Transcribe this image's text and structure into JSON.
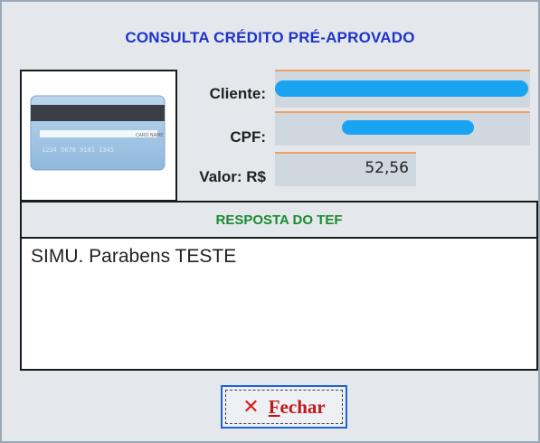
{
  "dialog": {
    "title": "CONSULTA CRÉDITO PRÉ-APROVADO"
  },
  "fields": {
    "cliente_label": "Cliente:",
    "cpf_label": "CPF:",
    "valor_label": "Valor: R$",
    "valor_value": "52,56"
  },
  "card_image": {
    "icon": "credit-card-icon",
    "name_text": "CARD NAME",
    "number_text": "1234 5678 9101 2345"
  },
  "response": {
    "header": "RESPOSTA DO TEF",
    "text": "SIMU. Parabens TESTE"
  },
  "buttons": {
    "close_first_letter": "F",
    "close_rest": "echar",
    "close_icon": "close-x-icon"
  },
  "colors": {
    "title": "#1d33c9",
    "response_header": "#1b8a2e",
    "close_text": "#c01818",
    "close_icon": "#d31d1d",
    "field_bg": "#cfd7df",
    "field_top_border": "#f0a060",
    "redaction": "#1aa3f0"
  }
}
